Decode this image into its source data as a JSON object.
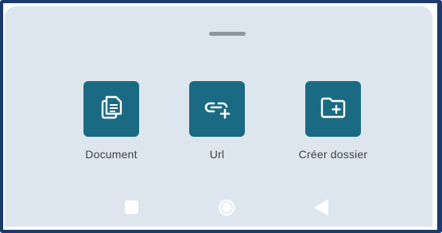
{
  "sheet": {
    "actions": [
      {
        "label": "Document",
        "icon": "document-icon"
      },
      {
        "label": "Url",
        "icon": "add-link-icon"
      },
      {
        "label": "Créer dossier",
        "icon": "create-folder-icon"
      }
    ]
  },
  "navbar": {
    "recents_icon": "square-recents-icon",
    "home_icon": "circle-home-icon",
    "back_icon": "triangle-back-icon"
  },
  "colors": {
    "tile": "#1a6a83",
    "sheet_background": "#dde6ee",
    "frame_border": "#1d3a6b",
    "label_text": "#3e4347"
  }
}
